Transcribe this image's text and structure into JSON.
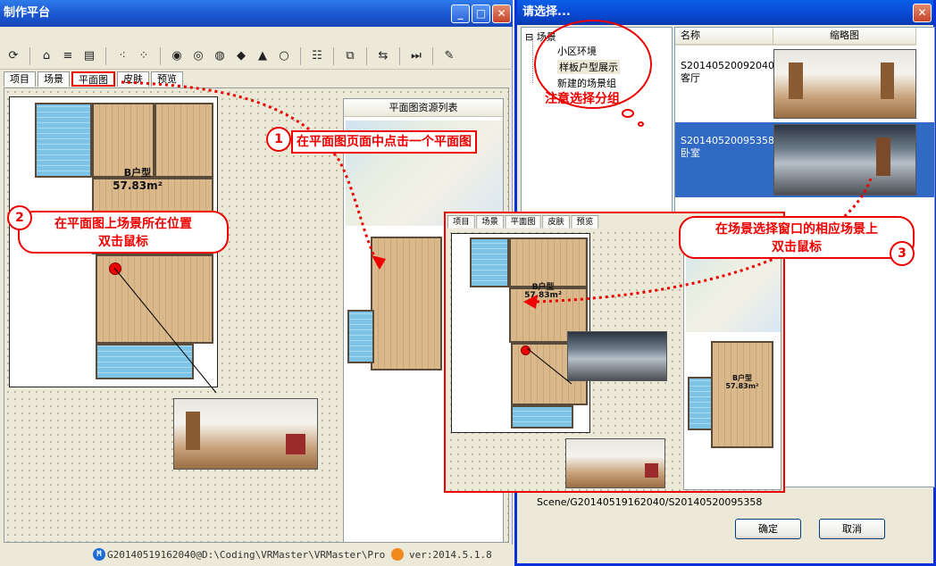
{
  "main": {
    "title": "制作平台",
    "tabs": [
      {
        "label": "项目"
      },
      {
        "label": "场景"
      },
      {
        "label": "平面图"
      },
      {
        "label": "皮肤"
      },
      {
        "label": "预览"
      }
    ],
    "active_tab": "平面图",
    "plan": {
      "type_label": "B户型",
      "area_label": "57.83m²"
    },
    "resource_list_header": "平面图资源列表",
    "inset_tabs": [
      {
        "label": "项目"
      },
      {
        "label": "场景"
      },
      {
        "label": "平面图"
      },
      {
        "label": "皮肤"
      },
      {
        "label": "预览"
      }
    ],
    "inset_plan": {
      "type_label": "B户型",
      "area_label": "57.83m²"
    },
    "right_plan": {
      "type_label": "B户型",
      "area_label": "57.83m²"
    },
    "status_text": "G20140519162040@D:\\Coding\\VRMaster\\VRMaster\\Project:",
    "version": "ver:2014.5.1.8"
  },
  "annotations": {
    "step1": {
      "number": "1",
      "text": "在平面图页面中点击一个平面图"
    },
    "step2": {
      "number": "2",
      "text_line1": "在平面图上场景所在位置",
      "text_line2": "双击鼠标"
    },
    "step3": {
      "number": "3",
      "text_line1": "在场景选择窗口的相应场景上",
      "text_line2": "双击鼠标"
    },
    "note": "注意选择分组"
  },
  "dialog": {
    "title": "请选择...",
    "tree": {
      "root": "场景",
      "root_toggle": "⊟",
      "items": [
        {
          "label": "小区环境"
        },
        {
          "label": "样板户型展示"
        },
        {
          "label": "新建的场景组"
        }
      ]
    },
    "list": {
      "columns": [
        "名称",
        "缩略图"
      ],
      "rows": [
        {
          "name_line1": "S20140520092040",
          "name_line2": "客厅",
          "selected": false
        },
        {
          "name_line1": "S20140520095358",
          "name_line2": "卧室",
          "selected": true
        }
      ]
    },
    "path": "Scene/G20140519162040/S20140520095358",
    "ok_label": "确定",
    "cancel_label": "取消"
  },
  "colors": {
    "accent_red": "#e00000",
    "titlebar_blue": "#1a56d1",
    "selection_blue": "#316ac5"
  }
}
